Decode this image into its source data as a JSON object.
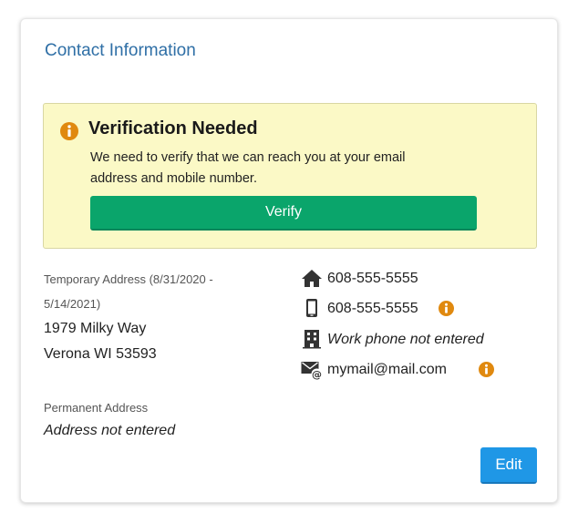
{
  "card": {
    "title": "Contact Information"
  },
  "alert": {
    "icon": "info-circle-icon",
    "heading": "Verification Needed",
    "message": "We need to verify that we can reach you at your email address and mobile number.",
    "button_label": "Verify"
  },
  "temporary_address": {
    "label": "Temporary Address (8/31/2020 - 5/14/2021)",
    "line1": "1979 Milky Way",
    "line2": "Verona WI 53593"
  },
  "permanent_address": {
    "label": "Permanent Address",
    "value": "Address not entered"
  },
  "contacts": [
    {
      "icon": "home-phone-icon",
      "value": "608-555-5555",
      "has_info": false
    },
    {
      "icon": "mobile-phone-icon",
      "value": "608-555-5555",
      "has_info": true
    },
    {
      "icon": "work-building-icon",
      "value": "Work phone not entered",
      "has_info": false
    },
    {
      "icon": "email-icon",
      "value": "mymail@mail.com",
      "has_info": true
    }
  ],
  "actions": {
    "edit_label": "Edit"
  },
  "colors": {
    "title_blue": "#2f6fa6",
    "alert_bg": "#fbf9c6",
    "verify_green": "#0aa56b",
    "edit_blue": "#1f97e6",
    "info_orange": "#e0890f"
  }
}
